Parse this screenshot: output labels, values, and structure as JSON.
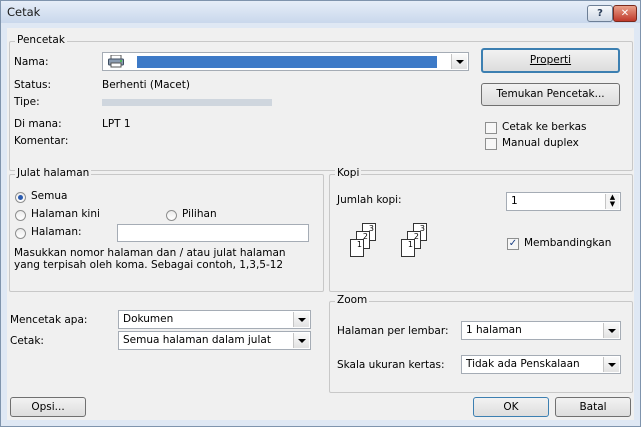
{
  "window": {
    "title": "Cetak",
    "help_glyph": "?",
    "close_glyph": "✕"
  },
  "printer": {
    "group_label": "Pencetak",
    "name_label": "Nama:",
    "status_label": "Status:",
    "status_value": "Berhenti (Macet)",
    "type_label": "Tipe:",
    "where_label": "Di mana:",
    "where_value": "LPT 1",
    "comment_label": "Komentar:",
    "properties_button": "Properti",
    "find_printer_button": "Temukan Pencetak...",
    "print_to_file_label": "Cetak ke berkas",
    "manual_duplex_label": "Manual duplex"
  },
  "page_range": {
    "group_label": "Julat halaman",
    "all_label": "Semua",
    "current_page_label": "Halaman kini",
    "selection_label": "Pilihan",
    "pages_label": "Halaman:",
    "hint_line1": "Masukkan nomor halaman dan / atau julat halaman",
    "hint_line2": "yang terpisah oleh koma. Sebagai contoh, 1,3,5-12"
  },
  "copies": {
    "group_label": "Kopi",
    "count_label": "Jumlah kopi:",
    "count_value": "1",
    "collate_label": "Membandingkan",
    "collate_glyph": "✓"
  },
  "print_what": {
    "label": "Mencetak apa:",
    "value": "Dokumen",
    "print_label": "Cetak:",
    "print_value": "Semua halaman dalam julat"
  },
  "zoom": {
    "group_label": "Zoom",
    "pages_per_sheet_label": "Halaman per lembar:",
    "pages_per_sheet_value": "1 halaman",
    "scale_label": "Skala ukuran kertas:",
    "scale_value": "Tidak ada Penskalaan"
  },
  "footer": {
    "options_button": "Opsi...",
    "ok_button": "OK",
    "cancel_button": "Batal"
  },
  "colors": {
    "window_frame": "#dfe8f4",
    "dialog_bg": "#f0f0f0",
    "focus_border": "#3c7fb1",
    "check_mark": "#1a3f84"
  },
  "icons": {
    "printer": "printer-icon"
  }
}
